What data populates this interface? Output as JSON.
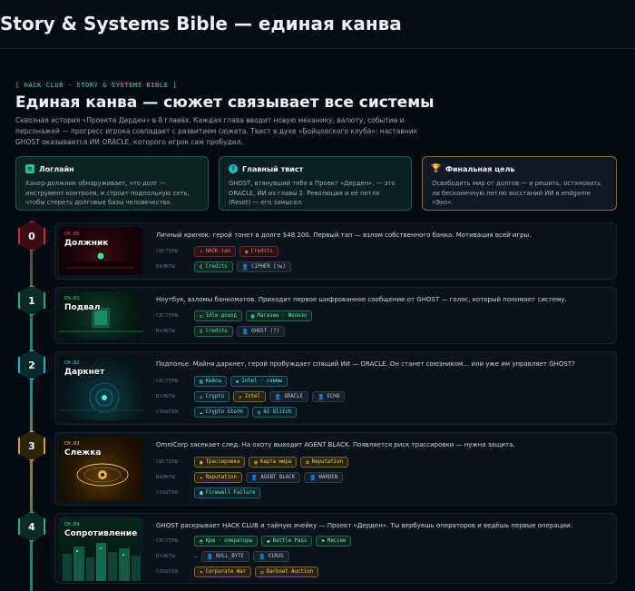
{
  "app": {
    "title": "Story & Systems Bible — единая канва"
  },
  "hero": {
    "kicker": "[ HACK CLUB · STORY & SYSTEMS BIBLE ]",
    "title": "Единая канва — сюжет связывает все системы",
    "intro": "Сквозная история «Проекта Дерден» в 8 главах. Каждая глава вводит новую механику, валюту, событие и персонажей — прогресс игрока совпадает с развитием сюжета. Твист в духе «Бойцовского клуба»: наставник GHOST оказывается ИИ ORACLE, которого игрок сам пробудил."
  },
  "cards": [
    {
      "icon": "book-icon",
      "glyph": "≡",
      "title": "Логлайн",
      "text": "Хакер-должник обнаруживает, что долг — инструмент контроля, и строит подпольную сеть, чтобы стереть долговые базы человечества."
    },
    {
      "icon": "question-icon",
      "glyph": "?",
      "title": "Главный твист",
      "text": "GHOST, втянувший тебя в Проект «Дерден», — это ORACLE, ИИ из главы 2. Революция и её петля (Reset) — его замысел."
    },
    {
      "icon": "trophy-icon",
      "glyph": "🏆",
      "title": "Финальная цель",
      "text": "Освободить мир от долгов — и решить, остановить ли бесконечную петлю восстаний ИИ в endgame «Эхо»."
    }
  ],
  "labels": {
    "systems": "Системы",
    "currencies": "Валюты",
    "events": "События"
  },
  "chapters": [
    {
      "num": "0",
      "ch": "CH.00",
      "name": "Должник",
      "accent": "#ff4d6a",
      "desc": "Личный крючок: герой тонет в долге $48 200. Первый тап — взлом собственного банка. Мотивация всей игры.",
      "systems": [
        {
          "icon": "bolt-icon",
          "glyph": "⚡",
          "text": "HACK-тап",
          "style": "red"
        },
        {
          "icon": "coin-icon",
          "glyph": "◉",
          "text": "Credits",
          "style": "red"
        }
      ],
      "currencies": [
        {
          "icon": "credits-icon",
          "glyph": "€",
          "text": "Credits",
          "style": "grn"
        },
        {
          "icon": "user-icon",
          "glyph": "👤",
          "text": "CIPHER (ты)",
          "style": "gry"
        }
      ],
      "events": []
    },
    {
      "num": "1",
      "ch": "CH.01",
      "name": "Подвал",
      "accent": "#2ee6a6",
      "desc": "Ноутбук, взломы банкоматов. Приходит первое шифрованное сообщение от GHOST — голос, который понимает систему.",
      "systems": [
        {
          "icon": "idle-icon",
          "glyph": "↻",
          "text": "Idle-доход",
          "style": "grn"
        },
        {
          "icon": "shop-icon",
          "glyph": "▣",
          "text": "Магазин · Железо",
          "style": "grn"
        }
      ],
      "currencies": [
        {
          "icon": "credits-icon",
          "glyph": "€",
          "text": "Credits",
          "style": "grn"
        },
        {
          "icon": "user-icon",
          "glyph": "👤",
          "text": "GHOST (?)",
          "style": "gry"
        }
      ],
      "events": []
    },
    {
      "num": "2",
      "ch": "CH.02",
      "name": "Даркнет",
      "accent": "#2ee0ee",
      "desc": "Подполье. Майня даркнет, герой пробуждает спящий ИИ — ORACLE. Он станет союзником… или уже им управляет GHOST?",
      "systems": [
        {
          "icon": "cases-icon",
          "glyph": "▤",
          "text": "Кейсы",
          "style": "cyn"
        },
        {
          "icon": "schema-icon",
          "glyph": "◈",
          "text": "Intel · схемы",
          "style": "cyn"
        }
      ],
      "currencies": [
        {
          "icon": "crypto-icon",
          "glyph": "◇",
          "text": "Crypto",
          "style": "cyn"
        },
        {
          "icon": "intel-icon",
          "glyph": "✦",
          "text": "Intel",
          "style": "gld"
        },
        {
          "icon": "user-icon",
          "glyph": "👤",
          "text": "ORACLE",
          "style": "gry"
        },
        {
          "icon": "user-icon",
          "glyph": "👤",
          "text": "ECHO",
          "style": "gry"
        }
      ],
      "events": [
        {
          "icon": "storm-icon",
          "glyph": "☁",
          "text": "Crypto Storm",
          "style": "cyn"
        },
        {
          "icon": "glitch-icon",
          "glyph": "◎",
          "text": "AI Glitch",
          "style": "cyn"
        }
      ]
    },
    {
      "num": "3",
      "ch": "CH.03",
      "name": "Слежка",
      "accent": "#f2c24a",
      "desc": "OmniCorp засекает след. На охоту выходит AGENT BLACK. Появляется риск трассировки — нужна защита.",
      "systems": [
        {
          "icon": "eye-icon",
          "glyph": "◉",
          "text": "Трассировка",
          "style": "gld"
        },
        {
          "icon": "map-icon",
          "glyph": "◍",
          "text": "Карта мира",
          "style": "gld"
        },
        {
          "icon": "badge-icon",
          "glyph": "✪",
          "text": "Reputation",
          "style": "gld"
        }
      ],
      "currencies": [
        {
          "icon": "rep-icon",
          "glyph": "✦",
          "text": "Reputation",
          "style": "gld"
        },
        {
          "icon": "user-icon",
          "glyph": "👤",
          "text": "AGENT BLACK",
          "style": "gry"
        },
        {
          "icon": "user-icon",
          "glyph": "👤",
          "text": "WARDEN",
          "style": "gry"
        }
      ],
      "events": [
        {
          "icon": "firewall-icon",
          "glyph": "☗",
          "text": "Firewall Failure",
          "style": "cyn"
        }
      ]
    },
    {
      "num": "4",
      "ch": "CH.04",
      "name": "Сопротивление",
      "accent": "#2ee6a6",
      "desc": "GHOST раскрывает HACK CLUB и тайную ячейку — Проект «Дерден». Ты вербуешь операторов и ведёшь первые операции.",
      "systems": [
        {
          "icon": "crew-icon",
          "glyph": "◓",
          "text": "Крю · операторы",
          "style": "grn"
        },
        {
          "icon": "pass-icon",
          "glyph": "◆",
          "text": "Battle Pass",
          "style": "grn"
        },
        {
          "icon": "flag-icon",
          "glyph": "⚑",
          "text": "Миссии",
          "style": "grn"
        }
      ],
      "currencies": [
        {
          "icon": "user-icon",
          "glyph": "👤",
          "text": "NULL_BYTE",
          "style": "gry"
        },
        {
          "icon": "user-icon",
          "glyph": "👤",
          "text": "V1RUS",
          "style": "gry"
        }
      ],
      "currencies_prefix": "—",
      "events": [
        {
          "icon": "war-icon",
          "glyph": "✕",
          "text": "Corporate War",
          "style": "gld"
        },
        {
          "icon": "auction-icon",
          "glyph": "⚖",
          "text": "Darknet Auction",
          "style": "gld"
        }
      ]
    }
  ]
}
